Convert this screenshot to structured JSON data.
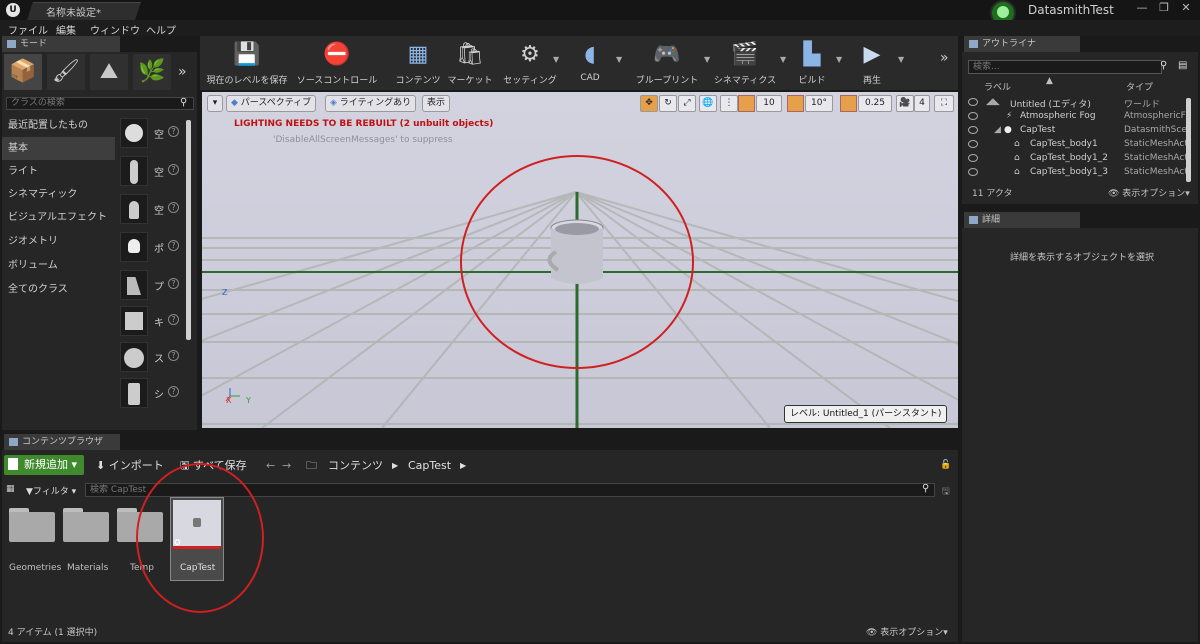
{
  "app": {
    "doc_tab": "名称未設定*",
    "project_name": "DatasmithTest",
    "logo": "unreal-logo",
    "window_controls": [
      "—",
      "❐",
      "✕"
    ]
  },
  "menu": [
    "ファイル",
    "編集",
    "ウィンドウ",
    "ヘルプ"
  ],
  "modes": {
    "tab": "モード",
    "icons": [
      "place-icon",
      "paint-icon",
      "landscape-icon",
      "foliage-icon"
    ],
    "search_placeholder": "クラスの検索",
    "categories": [
      "最近配置したもの",
      "基本",
      "ライト",
      "シネマティック",
      "ビジュアルエフェクト",
      "ジオメトリ",
      "ボリューム",
      "全てのクラス"
    ],
    "selected_category": "基本",
    "assets": [
      {
        "label": "空",
        "icon": "sphere-icon"
      },
      {
        "label": "空",
        "icon": "character-icon"
      },
      {
        "label": "空",
        "icon": "pawn-icon"
      },
      {
        "label": "ポ",
        "icon": "point-light-icon"
      },
      {
        "label": "プ",
        "icon": "player-start-icon"
      },
      {
        "label": "キ",
        "icon": "cube-icon"
      },
      {
        "label": "ス",
        "icon": "sphere-icon"
      },
      {
        "label": "シ",
        "icon": "cylinder-icon"
      }
    ]
  },
  "toolbar": {
    "buttons": [
      {
        "label": "現在のレベルを保存",
        "icon": "save-icon"
      },
      {
        "label": "ソースコントロール",
        "icon": "source-control-icon"
      },
      {
        "label": "コンテンツ",
        "icon": "content-icon"
      },
      {
        "label": "マーケット",
        "icon": "marketplace-icon"
      },
      {
        "label": "セッティング",
        "icon": "settings-icon"
      },
      {
        "label": "CAD",
        "icon": "cad-icon"
      },
      {
        "label": "ブループリント",
        "icon": "blueprint-icon"
      },
      {
        "label": "シネマティクス",
        "icon": "cinematics-icon"
      },
      {
        "label": "ビルド",
        "icon": "build-icon"
      },
      {
        "label": "再生",
        "icon": "play-icon"
      }
    ],
    "overflow": "»"
  },
  "viewport": {
    "perspective_label": "パースペクティブ",
    "lighting_label": "ライティングあり",
    "show_label": "表示",
    "warning": "LIGHTING NEEDS TO BE REBUILT (2 unbuilt objects)",
    "suppress_hint": "'DisableAllScreenMessages' to suppress",
    "grid_snap": "10",
    "rotation_snap": "10°",
    "scale_snap": "0.25",
    "camera_speed": "4",
    "level_label": "レベル: Untitled_1 (パーシスタント)",
    "axis_z": "Z",
    "axis_x": "X",
    "axis_y": "Y"
  },
  "outliner": {
    "tab": "アウトライナ",
    "search_placeholder": "検索...",
    "col_label": "ラベル",
    "col_type": "タイプ",
    "rows": [
      {
        "name": "Untitled (エディタ)",
        "type": "ワールド",
        "indent": 0
      },
      {
        "name": "Atmospheric Fog",
        "type": "AtmosphericFog",
        "indent": 2
      },
      {
        "name": "CapTest",
        "type": "DatasmithScene",
        "indent": 1
      },
      {
        "name": "CapTest_body1",
        "type": "StaticMeshActor",
        "indent": 2
      },
      {
        "name": "CapTest_body1_2",
        "type": "StaticMeshActor",
        "indent": 2
      },
      {
        "name": "CapTest_body1_3",
        "type": "StaticMeshActor",
        "indent": 2
      }
    ],
    "actor_count": "11 アクタ",
    "view_options": "表示オプション▾"
  },
  "details": {
    "tab": "詳細",
    "message": "詳細を表示するオブジェクトを選択"
  },
  "content_browser": {
    "tab": "コンテンツブラウザ",
    "add_new": "新規追加",
    "import": "インポート",
    "save_all": "すべて保存",
    "path_root": "コンテンツ",
    "path_child": "CapTest",
    "filter_label": "フィルタ",
    "search_placeholder": "検索 CapTest",
    "folders": [
      "Geometries",
      "Materials",
      "Temp"
    ],
    "selected_asset": "CapTest",
    "status": "4 アイテム (1 選択中)",
    "view_options": "表示オプション▾"
  },
  "colors": {
    "accent_green": "#3f8a2c",
    "annotation_red": "#d02020",
    "warning_red": "#c01010",
    "snap_orange": "#e7a04a"
  }
}
